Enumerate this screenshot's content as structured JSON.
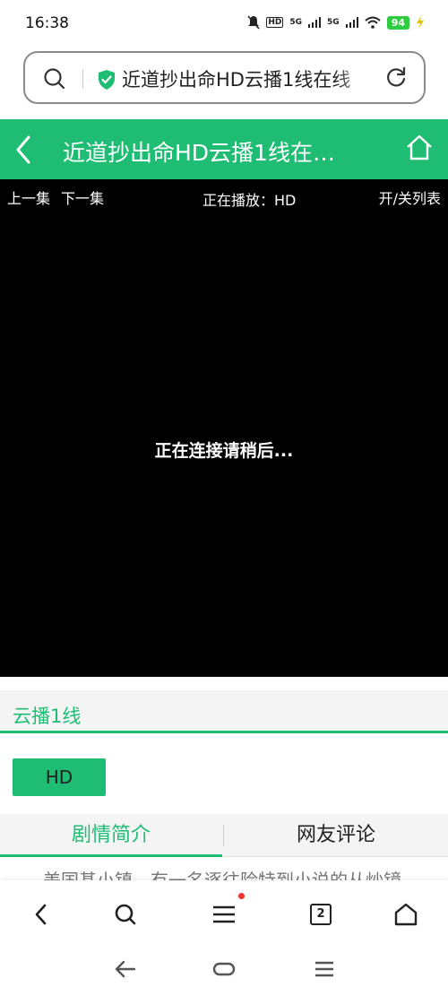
{
  "status_bar": {
    "time": "16:38",
    "hd_label": "HD",
    "network_1": "5G",
    "network_2": "5G",
    "battery": "94"
  },
  "address_bar": {
    "url_text": "近道抄出命HD云播1线在线"
  },
  "header": {
    "title": "近道抄出命HD云播1线在…"
  },
  "player": {
    "prev_episode": "上一集",
    "next_episode": "下一集",
    "now_playing": "正在播放：HD",
    "toggle_list": "开/关列表",
    "loading_text": "正在连接请稍后..."
  },
  "source": {
    "title": "云播1线",
    "episodes": [
      "HD"
    ]
  },
  "tabs": {
    "plot": "剧情简介",
    "comments": "网友评论"
  },
  "synopsis": "美国基小镇，有一名逐往险特到小说的从炒镜",
  "bottom_nav": {
    "tab_count": "2"
  },
  "colors": {
    "accent": "#1ebd73",
    "player_bg": "#000000",
    "notification_dot": "#f23030"
  }
}
